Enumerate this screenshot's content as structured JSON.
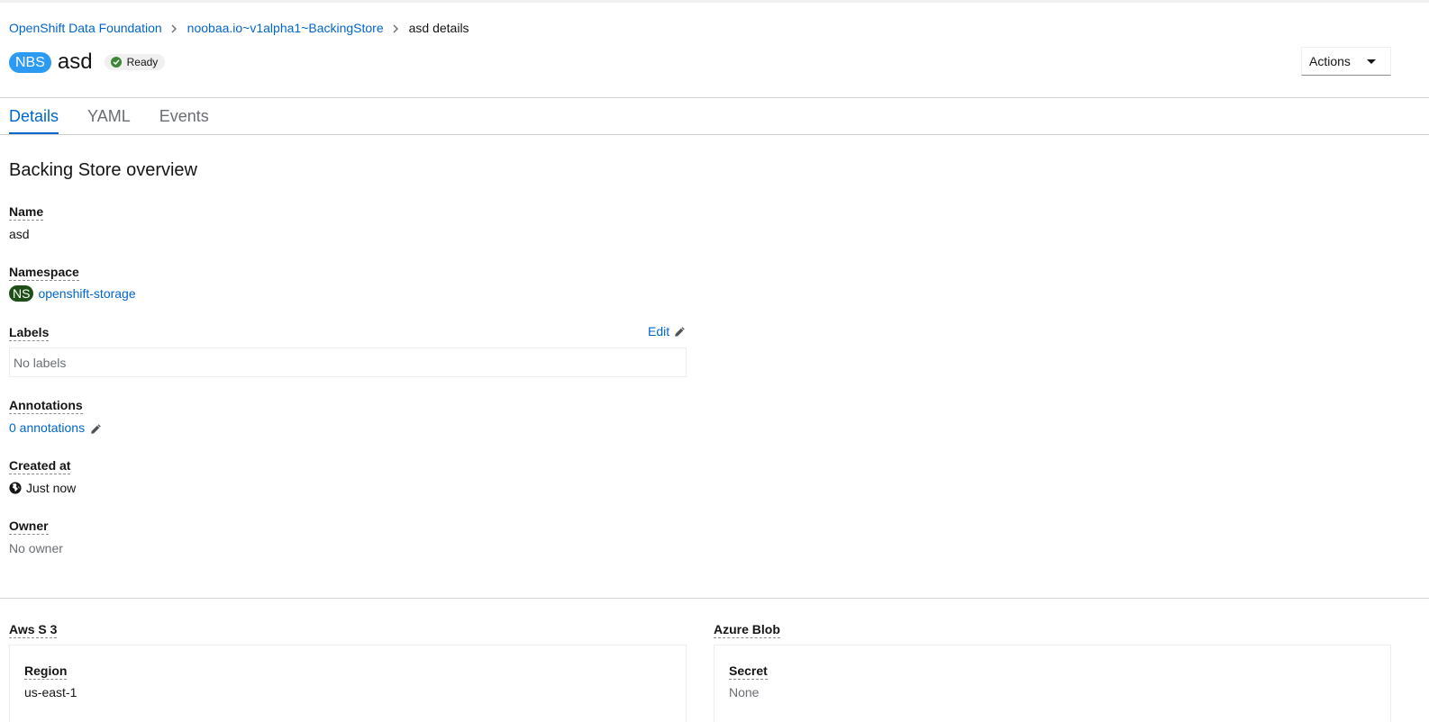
{
  "breadcrumb": {
    "items": [
      "OpenShift Data Foundation",
      "noobaa.io~v1alpha1~BackingStore"
    ],
    "current": "asd details"
  },
  "header": {
    "resource_badge": "NBS",
    "title": "asd",
    "status": "Ready",
    "status_color": "#3e8635",
    "actions_label": "Actions"
  },
  "tabs": [
    {
      "label": "Details",
      "active": true
    },
    {
      "label": "YAML",
      "active": false
    },
    {
      "label": "Events",
      "active": false
    }
  ],
  "overview": {
    "title": "Backing Store overview",
    "name_label": "Name",
    "name_value": "asd",
    "namespace_label": "Namespace",
    "namespace_badge": "NS",
    "namespace_value": "openshift-storage",
    "labels_label": "Labels",
    "labels_edit": "Edit",
    "labels_value": "No labels",
    "annotations_label": "Annotations",
    "annotations_value": "0 annotations",
    "created_label": "Created at",
    "created_value": "Just now",
    "owner_label": "Owner",
    "owner_value": "No owner"
  },
  "providers": {
    "aws": {
      "title": "Aws S 3",
      "field_label": "Region",
      "field_value": "us-east-1"
    },
    "azure": {
      "title": "Azure Blob",
      "field_label": "Secret",
      "field_value": "None"
    }
  },
  "colors": {
    "link": "#0066cc",
    "resource_badge": "#2b9af3",
    "namespace_badge": "#1e4f18"
  },
  "icons": [
    "chevron-right-icon",
    "check-circle-icon",
    "caret-down-icon",
    "pencil-icon",
    "globe-icon"
  ]
}
